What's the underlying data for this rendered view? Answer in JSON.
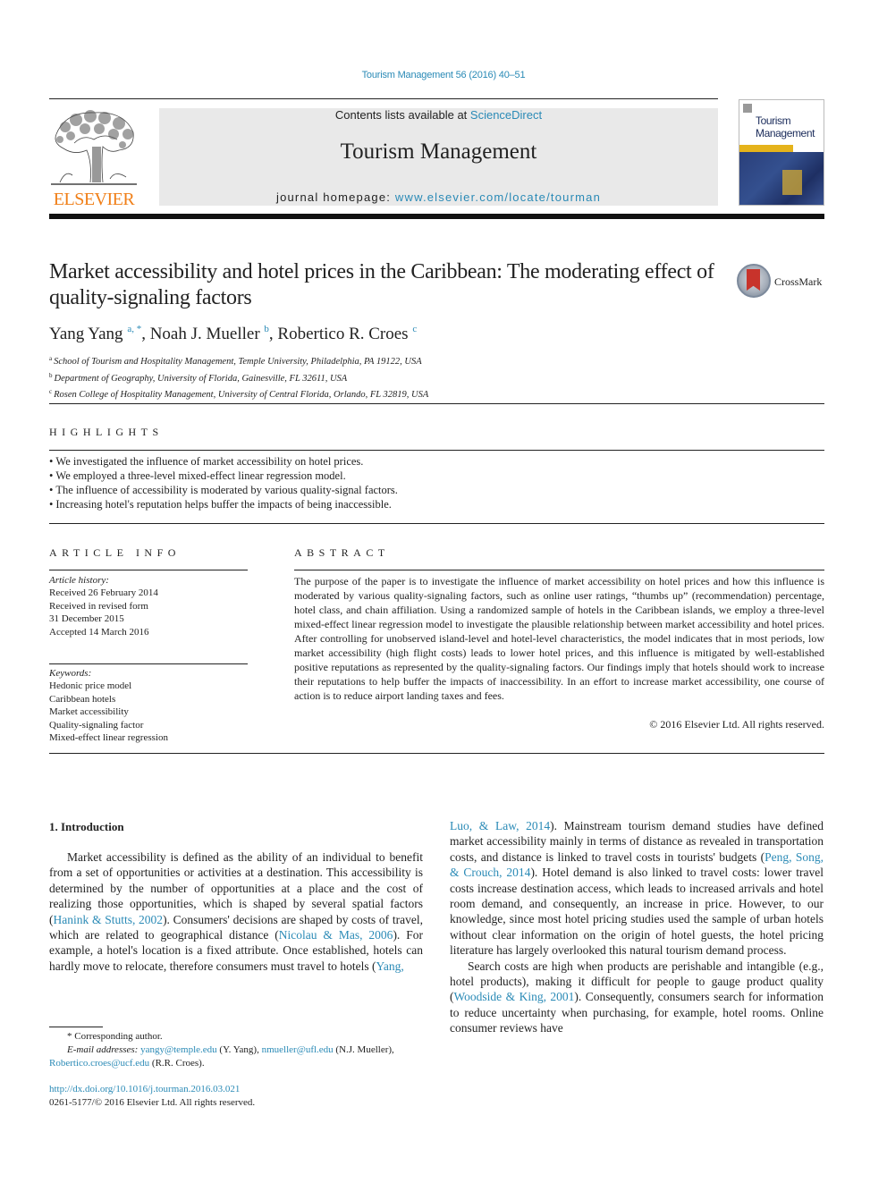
{
  "journal_ref": "Tourism Management 56 (2016) 40–51",
  "header": {
    "contents_prefix": "Contents lists available at ",
    "contents_link": "ScienceDirect",
    "journal_title": "Tourism Management",
    "homepage_prefix": "journal homepage: ",
    "homepage_link": "www.elsevier.com/locate/tourman",
    "publisher_logo_text": "ELSEVIER",
    "cover_title_line1": "Tourism",
    "cover_title_line2": "Management"
  },
  "article": {
    "title": "Market accessibility and hotel prices in the Caribbean: The moderating effect of quality-signaling factors",
    "crossmark_label": "CrossMark",
    "authors": [
      {
        "name": "Yang Yang",
        "sup": "a, *"
      },
      {
        "name": "Noah J. Mueller",
        "sup": "b"
      },
      {
        "name": "Robertico R. Croes",
        "sup": "c"
      }
    ],
    "affiliations": [
      {
        "key": "a",
        "text": "School of Tourism and Hospitality Management, Temple University, Philadelphia, PA 19122, USA"
      },
      {
        "key": "b",
        "text": "Department of Geography, University of Florida, Gainesville, FL 32611, USA"
      },
      {
        "key": "c",
        "text": "Rosen College of Hospitality Management, University of Central Florida, Orlando, FL 32819, USA"
      }
    ]
  },
  "highlights": {
    "title": "HIGHLIGHTS",
    "items": [
      "We investigated the influence of market accessibility on hotel prices.",
      "We employed a three-level mixed-effect linear regression model.",
      "The influence of accessibility is moderated by various quality-signal factors.",
      "Increasing hotel's reputation helps buffer the impacts of being inaccessible."
    ]
  },
  "article_info": {
    "title": "ARTICLE INFO",
    "history_label": "Article history:",
    "history": [
      "Received 26 February 2014",
      "Received in revised form",
      "31 December 2015",
      "Accepted 14 March 2016"
    ],
    "keywords_label": "Keywords:",
    "keywords": [
      "Hedonic price model",
      "Caribbean hotels",
      "Market accessibility",
      "Quality-signaling factor",
      "Mixed-effect linear regression"
    ]
  },
  "abstract": {
    "title": "ABSTRACT",
    "text": "The purpose of the paper is to investigate the influence of market accessibility on hotel prices and how this influence is moderated by various quality-signaling factors, such as online user ratings, “thumbs up” (recommendation) percentage, hotel class, and chain affiliation. Using a randomized sample of hotels in the Caribbean islands, we employ a three-level mixed-effect linear regression model to investigate the plausible relationship between market accessibility and hotel prices. After controlling for unobserved island-level and hotel-level characteristics, the model indicates that in most periods, low market accessibility (high flight costs) leads to lower hotel prices, and this influence is mitigated by well-established positive reputations as represented by the quality-signaling factors. Our findings imply that hotels should work to increase their reputations to help buffer the impacts of inaccessibility. In an effort to increase market accessibility, one course of action is to reduce airport landing taxes and fees.",
    "copyright": "© 2016 Elsevier Ltd. All rights reserved."
  },
  "body": {
    "section_heading": "1.  Introduction",
    "left_p1_a": "Market accessibility is defined as the ability of an individual to benefit from a set of opportunities or activities at a destination. This accessibility is determined by the number of opportunities at a place and the cost of realizing those opportunities, which is shaped by several spatial factors (",
    "left_cite1": "Hanink & Stutts, 2002",
    "left_p1_b": "). Consumers' decisions are shaped by costs of travel, which are related to geographical distance (",
    "left_cite2": "Nicolau & Mas, 2006",
    "left_p1_c": "). For example, a hotel's location is a fixed attribute. Once established, hotels can hardly move to relocate, therefore consumers must travel to hotels (",
    "left_cite3": "Yang,",
    "right_cite3": "Luo, & Law, 2014",
    "right_p1_a": "). Mainstream tourism demand studies have defined market accessibility mainly in terms of distance as revealed in transportation costs, and distance is linked to travel costs in tourists' budgets (",
    "right_cite4": "Peng, Song, & Crouch, 2014",
    "right_p1_b": "). Hotel demand is also linked to travel costs: lower travel costs increase destination access, which leads to increased arrivals and hotel room demand, and consequently, an increase in price. However, to our knowledge, since most hotel pricing studies used the sample of urban hotels without clear information on the origin of hotel guests, the hotel pricing literature has largely overlooked this natural tourism demand process.",
    "right_p2_a": "Search costs are high when products are perishable and intangible (e.g., hotel products), making it difficult for people to gauge product quality (",
    "right_cite5": "Woodside & King, 2001",
    "right_p2_b": "). Consequently, consumers search for information to reduce uncertainty when purchasing, for example, hotel rooms. Online consumer reviews have"
  },
  "footnotes": {
    "corresponding": "* Corresponding author.",
    "email_label": "E-mail addresses:",
    "email1": "yangy@temple.edu",
    "email1_who": " (Y. Yang), ",
    "email2": "nmueller@ufl.edu",
    "email2_who": " (N.J. Mueller),",
    "email3": "Robertico.croes@ucf.edu",
    "email3_who": " (R.R. Croes).",
    "doi": "http://dx.doi.org/10.1016/j.tourman.2016.03.021",
    "issn_copyright": "0261-5177/© 2016 Elsevier Ltd. All rights reserved."
  }
}
